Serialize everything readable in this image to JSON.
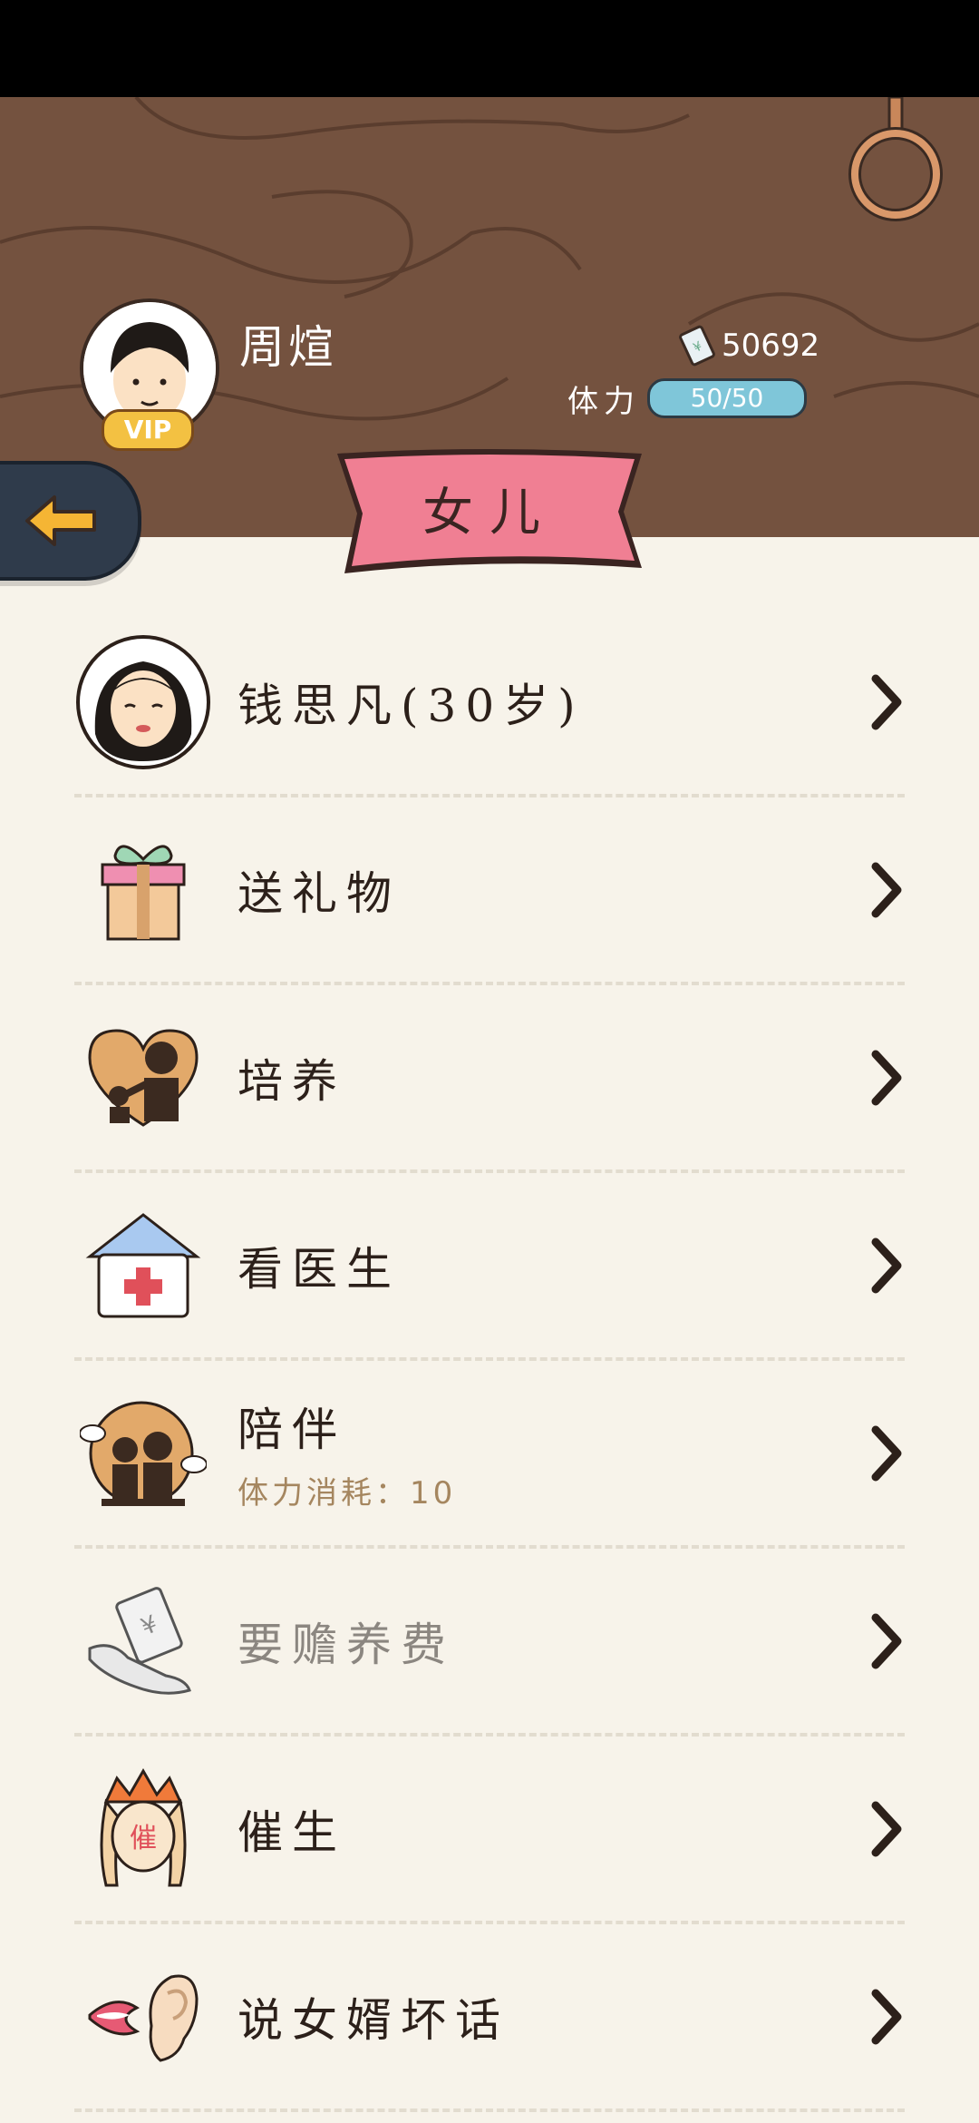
{
  "player": {
    "name": "周煊",
    "badge": "VIP",
    "money": "50692",
    "stamina_label": "体力",
    "stamina_value": "50/50",
    "stamina_fraction": 1.0
  },
  "page_title": "女儿",
  "menu": [
    {
      "label": "钱思凡(30岁)",
      "icon": "daughter-avatar-icon"
    },
    {
      "label": "送礼物",
      "icon": "gift-icon"
    },
    {
      "label": "培养",
      "icon": "nurture-heart-icon"
    },
    {
      "label": "看医生",
      "icon": "hospital-icon"
    },
    {
      "label": "陪伴",
      "sub": "体力消耗：10",
      "icon": "companion-icon"
    },
    {
      "label": "要赡养费",
      "icon": "money-hand-icon",
      "disabled": true
    },
    {
      "label": "催生",
      "icon": "urge-birth-icon"
    },
    {
      "label": "说女婿坏话",
      "icon": "gossip-ear-icon"
    }
  ],
  "colors": {
    "header_wood": "#74523f",
    "ribbon": "#f07f93",
    "stamina": "#7fc6d9",
    "background": "#f7f3ea"
  }
}
